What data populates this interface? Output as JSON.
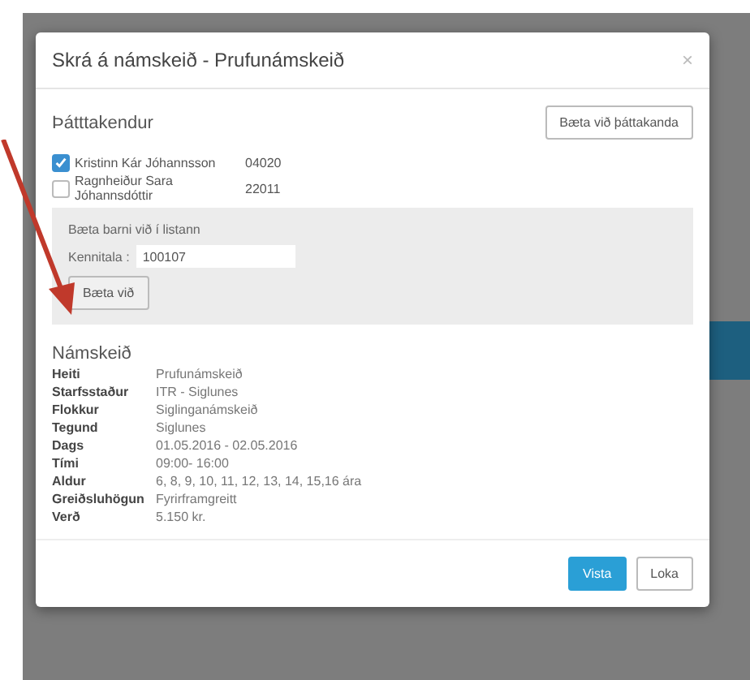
{
  "dialog": {
    "title": "Skrá á námskeið - Prufunámskeið",
    "close": "×"
  },
  "participants": {
    "heading": "Þátttakendur",
    "add_button": "Bæta við þáttakanda",
    "items": [
      {
        "name": "Kristinn Kár Jóhannsson",
        "id": "04020",
        "checked": true
      },
      {
        "name": "Ragnheiður Sara Jóhannsdóttir",
        "id": "22011",
        "checked": false
      }
    ]
  },
  "add_child": {
    "heading": "Bæta barni við í listann",
    "label": "Kennitala :",
    "value": "100107",
    "button": "Bæta við"
  },
  "course": {
    "heading": "Námskeið",
    "rows": [
      {
        "label": "Heiti",
        "value": "Prufunámskeið"
      },
      {
        "label": "Starfsstaður",
        "value": "ITR - Siglunes"
      },
      {
        "label": "Flokkur",
        "value": "Siglinganámskeið"
      },
      {
        "label": "Tegund",
        "value": "Siglunes"
      },
      {
        "label": "Dags",
        "value": "01.05.2016 - 02.05.2016"
      },
      {
        "label": "Tími",
        "value": "09:00- 16:00"
      },
      {
        "label": "Aldur",
        "value": "6, 8, 9, 10, 11, 12, 13, 14, 15,16 ára"
      },
      {
        "label": "Greiðsluhögun",
        "value": "Fyrirframgreitt"
      },
      {
        "label": "Verð",
        "value": "5.150 kr."
      }
    ]
  },
  "footer": {
    "buttons": [
      {
        "label": "Vista",
        "kind": "primary"
      },
      {
        "label": "Loka",
        "kind": "default"
      }
    ]
  }
}
